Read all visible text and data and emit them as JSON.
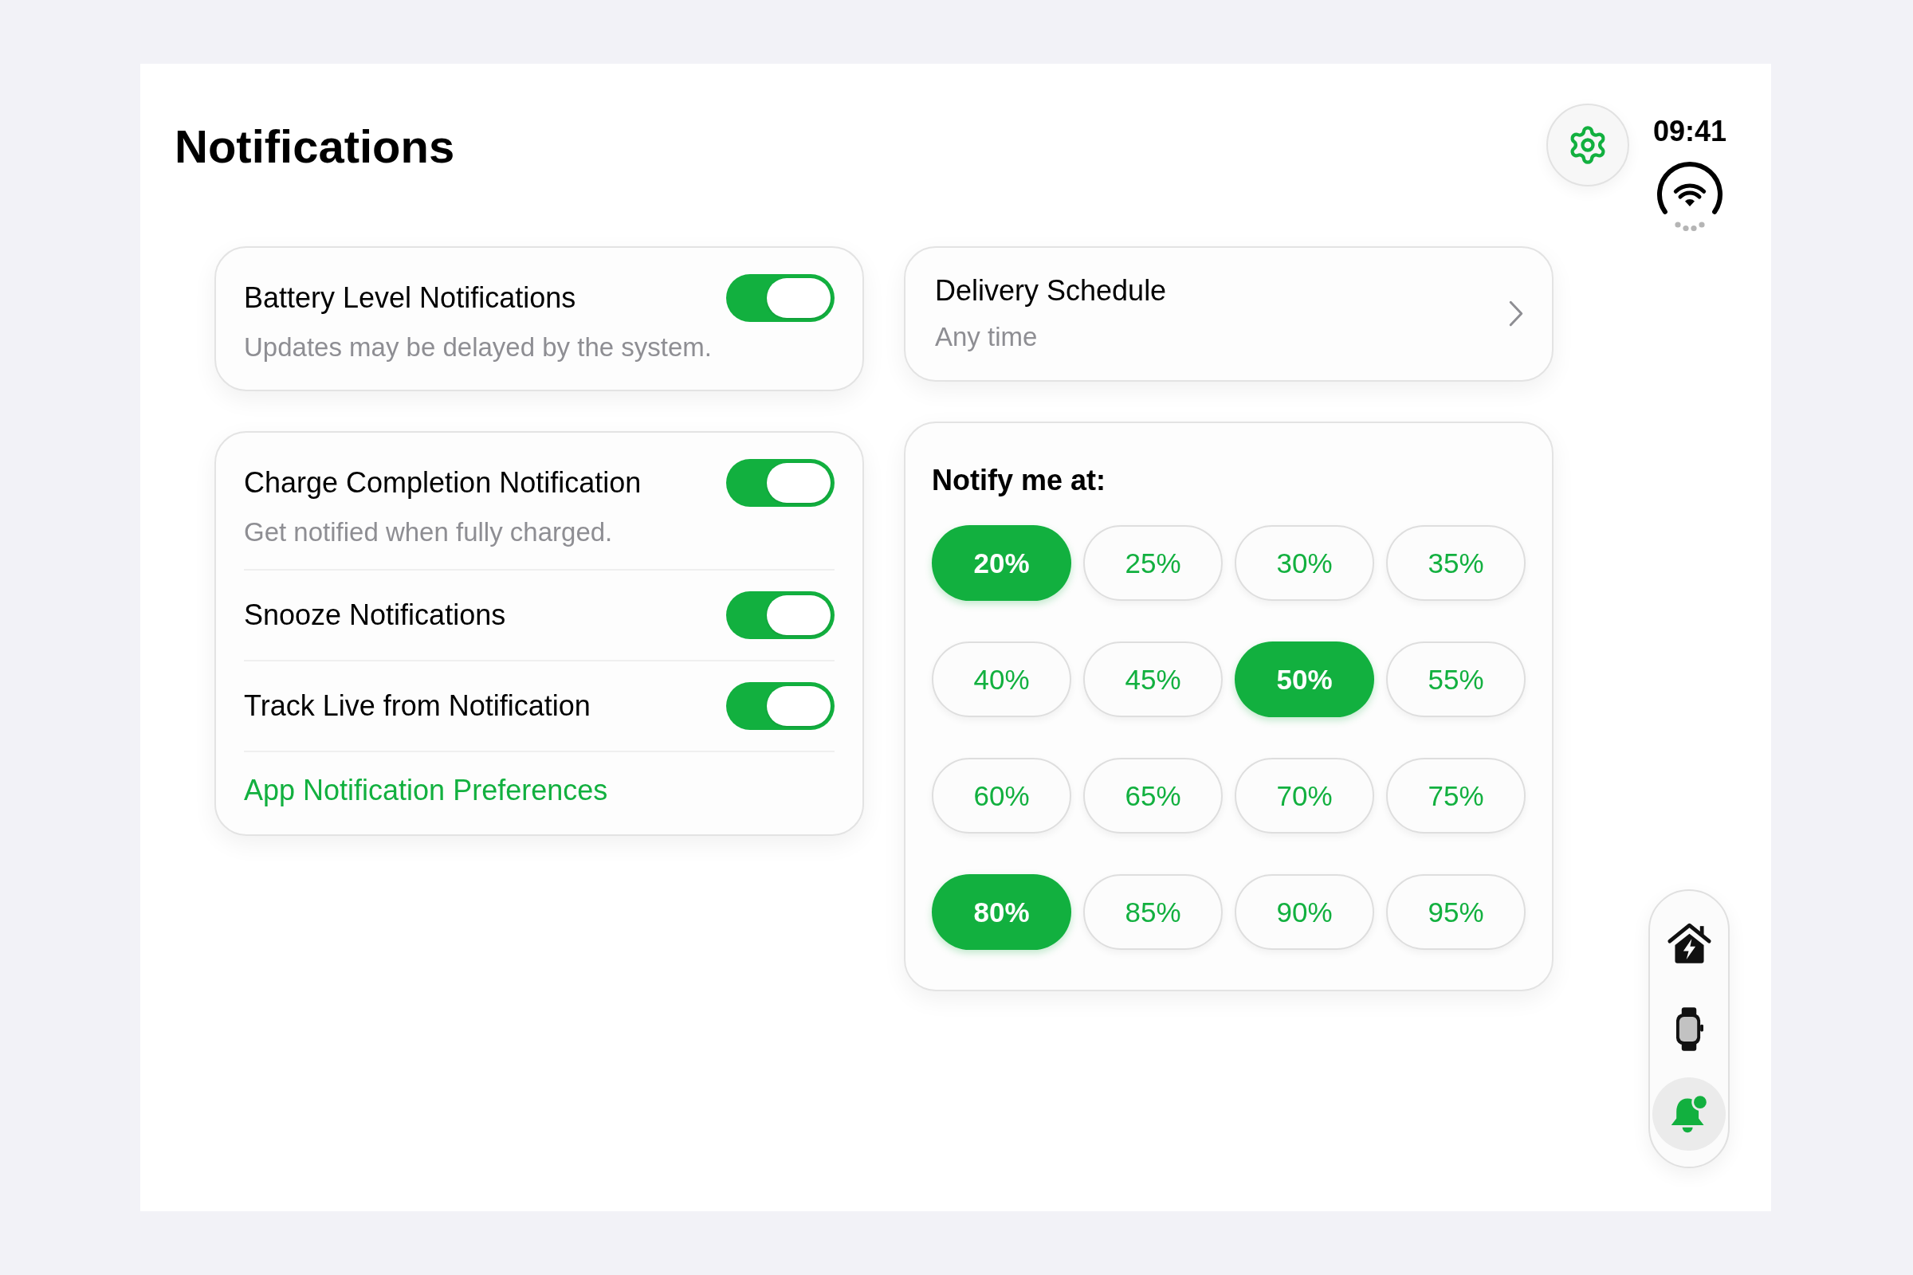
{
  "header": {
    "title": "Notifications",
    "time": "09:41"
  },
  "settings_cards": [
    {
      "rows": [
        {
          "kind": "toggle",
          "label": "Battery Level Notifications",
          "description": "Updates may be delayed by the system.",
          "on": true
        }
      ]
    },
    {
      "rows": [
        {
          "kind": "toggle",
          "label": "Charge Completion Notification",
          "description": "Get notified when fully charged.",
          "on": true
        },
        {
          "kind": "toggle",
          "label": "Snooze Notifications",
          "on": true
        },
        {
          "kind": "toggle",
          "label": "Track Live from Notification",
          "on": true
        },
        {
          "kind": "link",
          "label": "App Notification Preferences"
        }
      ]
    }
  ],
  "delivery_schedule": {
    "label": "Delivery Schedule",
    "value": "Any time"
  },
  "notify_at": {
    "title": "Notify me at:",
    "options": [
      {
        "label": "20%",
        "selected": true
      },
      {
        "label": "25%",
        "selected": false
      },
      {
        "label": "30%",
        "selected": false
      },
      {
        "label": "35%",
        "selected": false
      },
      {
        "label": "40%",
        "selected": false
      },
      {
        "label": "45%",
        "selected": false
      },
      {
        "label": "50%",
        "selected": true
      },
      {
        "label": "55%",
        "selected": false
      },
      {
        "label": "60%",
        "selected": false
      },
      {
        "label": "65%",
        "selected": false
      },
      {
        "label": "70%",
        "selected": false
      },
      {
        "label": "75%",
        "selected": false
      },
      {
        "label": "80%",
        "selected": true
      },
      {
        "label": "85%",
        "selected": false
      },
      {
        "label": "90%",
        "selected": false
      },
      {
        "label": "95%",
        "selected": false
      }
    ]
  },
  "nav": {
    "items": [
      {
        "kind": "home-energy",
        "selected": false
      },
      {
        "kind": "watch",
        "selected": false
      },
      {
        "kind": "notifications",
        "selected": true
      }
    ]
  }
}
